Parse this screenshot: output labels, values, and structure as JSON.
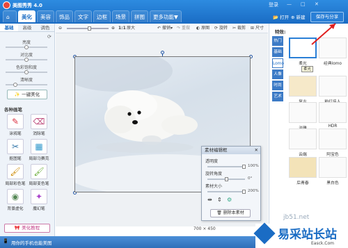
{
  "app": {
    "title": "美图秀秀 4.0",
    "window_controls": [
      "登录",
      "—",
      "□",
      "✕"
    ]
  },
  "tabs": [
    "美化",
    "美容",
    "饰品",
    "文字",
    "边框",
    "场景",
    "拼图",
    "更多功能▼"
  ],
  "top_right": {
    "open": "打开",
    "new": "新建",
    "save": "保存与分享"
  },
  "left_panel": {
    "tabs": [
      "基础",
      "高级",
      "调色"
    ],
    "sliders": [
      {
        "label": "亮度",
        "value": 0.5
      },
      {
        "label": "对比度",
        "value": 0.5
      },
      {
        "label": "色彩饱和度",
        "value": 0.5
      },
      {
        "label": "清晰度",
        "value": 0.2
      }
    ],
    "one_click": "一键美化",
    "pens_title": "各种画笔",
    "pens": [
      {
        "label": "涂鸦笔",
        "icon": "✎"
      },
      {
        "label": "消除笔",
        "icon": "⌫"
      },
      {
        "label": "抠图笔",
        "icon": "✂"
      },
      {
        "label": "局部马赛克",
        "icon": "▦"
      },
      {
        "label": "局部彩色笔",
        "icon": "🖌"
      },
      {
        "label": "局部变色笔",
        "icon": "🖌"
      },
      {
        "label": "背景虚化",
        "icon": "◉"
      },
      {
        "label": "魔幻笔",
        "icon": "✦"
      }
    ],
    "tutorial": "美化教程"
  },
  "toolbar": {
    "zoom": "1:1",
    "original_size": "原大",
    "undo": "撤销",
    "redo": "重做",
    "compare": "原图",
    "rotate": "旋转",
    "crop": "裁剪",
    "resize": "尺寸"
  },
  "canvas": {
    "dimensions": "700 × 450"
  },
  "edit_panel": {
    "title": "素材编辑框",
    "rows": [
      {
        "label": "透明度",
        "value": "100%",
        "fraction": 1.0
      },
      {
        "label": "旋转角度",
        "value": "0°",
        "fraction": 0.5
      },
      {
        "label": "素材大小",
        "value": "200%",
        "fraction": 1.0
      }
    ],
    "delete_btn": "删除本素材"
  },
  "status": {
    "text": "用你的手机也能美图"
  },
  "right_panel": {
    "title": "特效:",
    "categories": [
      "热门",
      "基础",
      "Lomo",
      "人像",
      "时尚",
      "艺术"
    ],
    "effects": [
      "柔光",
      "经典lomo",
      "复古",
      "粉红佳人",
      "淡雅",
      "HDR",
      "云端",
      "阿宝色",
      "后青春",
      "黑白色"
    ],
    "tooltip": "柔光"
  },
  "watermark": {
    "site": "jb51.net",
    "brand": "易采站长站",
    "sub": "Easck.Com"
  }
}
